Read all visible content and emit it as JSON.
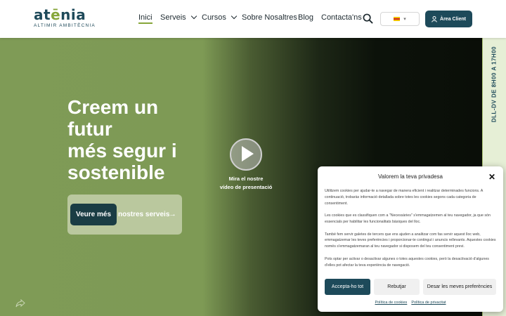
{
  "brand": {
    "name_start": "at",
    "name_accent": "ē",
    "name_end": "nia",
    "tagline": "ALTIMIR AMBITÈCNIA"
  },
  "nav": {
    "items": [
      {
        "label": "Inici"
      },
      {
        "label": "Serveis"
      },
      {
        "label": "Cursos"
      },
      {
        "label": "Sobre Nosaltres"
      },
      {
        "label": "Blog"
      },
      {
        "label": "Contacta'ns"
      }
    ],
    "client_area": "Àrea Client"
  },
  "hero": {
    "title_lines": [
      "Creem un",
      "futur",
      "més segur i",
      "sostenible"
    ],
    "cta_button": "Veure més",
    "cta_link": "nostres serveis",
    "cta_arrow": "→",
    "video_label_line1": "Mira el nostre",
    "video_label_line2": "vídeo de presentació"
  },
  "side_strip": {
    "text": "DLL-DV  DE 8H00 A 17H00"
  },
  "cookie_modal": {
    "title": "Valorem la teva privadesa",
    "close": "✕",
    "paragraphs": [
      "Utilitzem cookies per ajudar-te a navegar de manera eficient i realitzar determinades funcions. A continuació, trobaràs informació detallada sobre totes les cookies segons cada categoria de consentiment.",
      "Les cookies que es classifiquen com a \"Necessàries\" s'emmagatzemen al teu navegador, ja que són essencials per habilitar les funcionalitats bàsiques del lloc.",
      "També fem servir galetes de tercers que ens ajuden a analitzar com fas servir aquest lloc web, emmagatzemar les teves preferències i proporcionar-te contingut i anuncis rellevants. Aquestes cookies només s'emmagatzemaran al teu navegador si disposem del teu consentiment previ.",
      "Pots optar per activar o desactivar algunes o totes aquestes cookies, però la desactivació d'algunes d'elles pot afectar la teva experiència de navegació."
    ],
    "accept": "Accepta-ho tot",
    "reject": "Rebutjar",
    "preferences": "Desar les meves preferències",
    "link_cookies": "Política de cookies",
    "link_privacy": "Política de privacitat"
  },
  "colors": {
    "primary": "#1d4a5a",
    "accent": "#86a63a",
    "strip": "#e6efd6"
  }
}
